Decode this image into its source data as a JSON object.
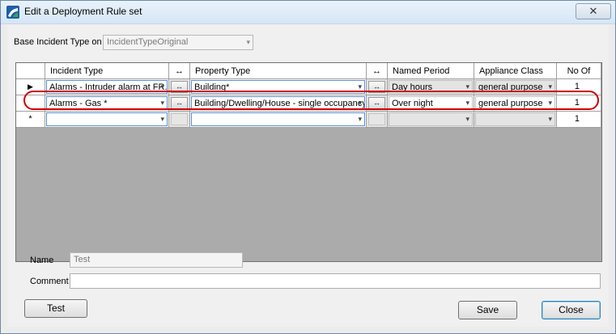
{
  "window": {
    "title": "Edit a Deployment Rule set",
    "close_glyph": "✕"
  },
  "base_type": {
    "label": "Base Incident Type on",
    "value": "IncidentTypeOriginal"
  },
  "grid": {
    "headers": {
      "incident_type": "Incident Type",
      "swap1": "↔",
      "property_type": "Property Type",
      "swap2": "↔",
      "named_period": "Named Period",
      "appliance_class": "Appliance Class",
      "no_of": "No Of"
    },
    "rows": [
      {
        "marker": "▶",
        "incident_type": "Alarms - Intruder alarm at FR...",
        "property_type": "Building*",
        "named_period": "Day hours",
        "appliance_class": "general purpose",
        "no_of": "1"
      },
      {
        "marker": "",
        "incident_type": "Alarms - Gas *",
        "property_type": "Building/Dwelling/House - single occupancy",
        "named_period": "Over night",
        "appliance_class": "general purpose",
        "no_of": "1"
      },
      {
        "marker": "*",
        "incident_type": "",
        "property_type": "",
        "named_period": "",
        "appliance_class": "",
        "no_of": "1"
      }
    ],
    "swap_glyph": "↔",
    "dropdown_glyph": "▾"
  },
  "form": {
    "name_label": "Name",
    "name_value": "Test",
    "comment_label": "Comment",
    "comment_value": ""
  },
  "buttons": {
    "test": "Test",
    "save": "Save",
    "close": "Close"
  },
  "colors": {
    "highlight": "#cc0000",
    "grid_background": "#ababab"
  }
}
